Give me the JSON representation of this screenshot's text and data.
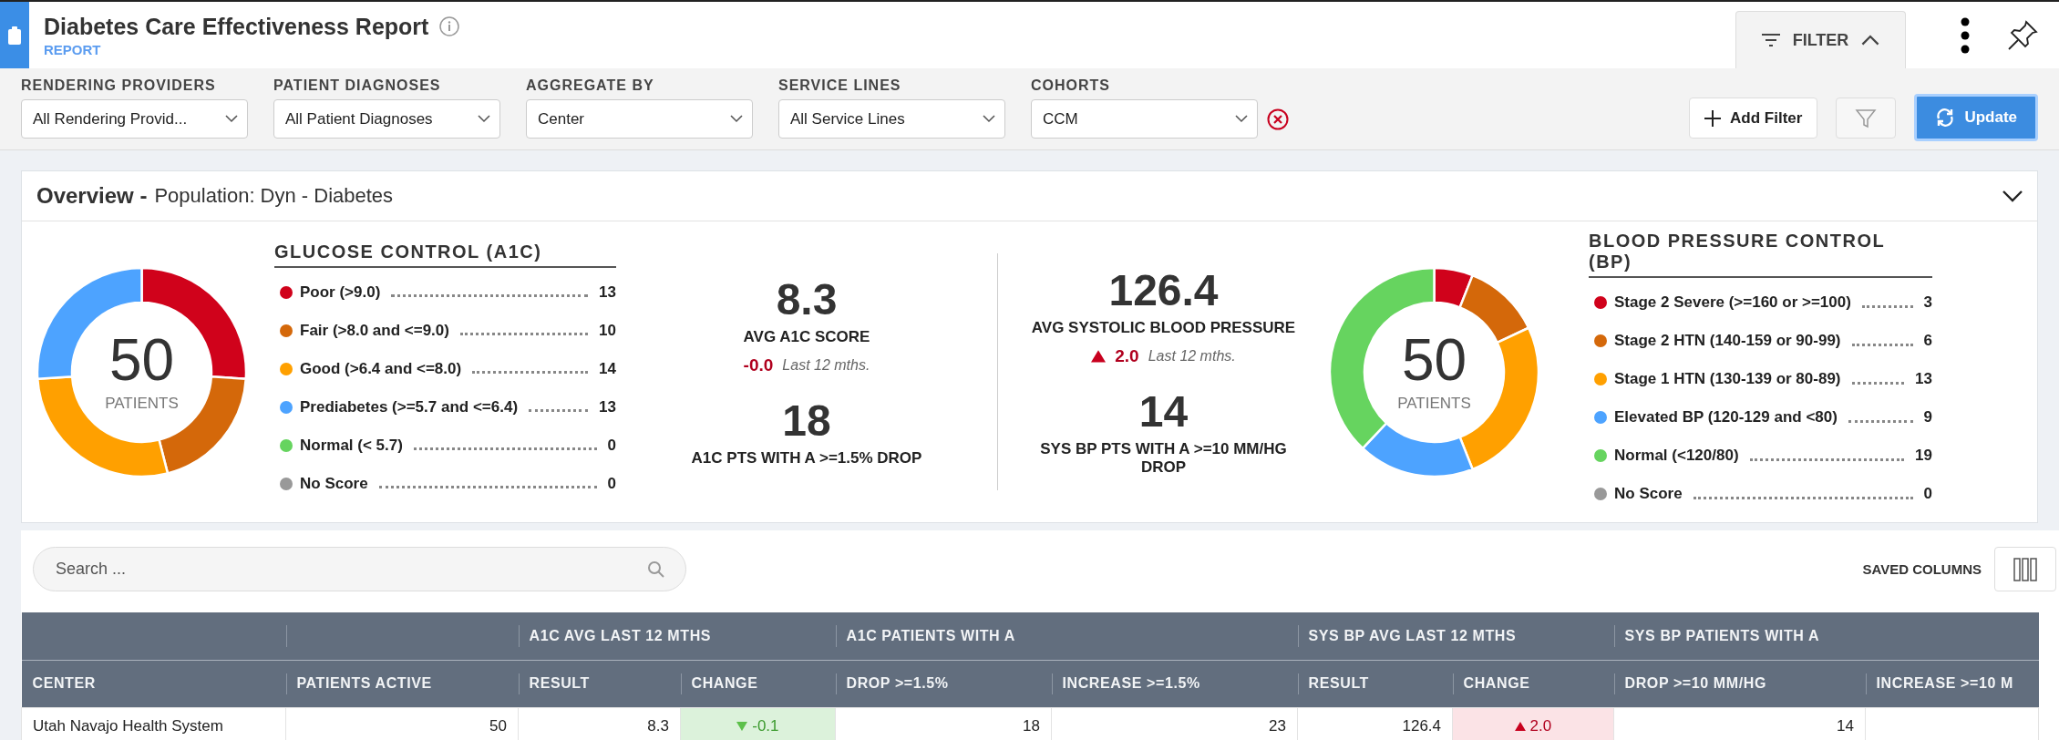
{
  "header": {
    "title": "Diabetes Care Effectiveness Report",
    "subtitle": "REPORT",
    "filter_tab": {
      "label": "FILTER",
      "expanded": true
    }
  },
  "filters": [
    {
      "label": "RENDERING PROVIDERS",
      "value": "All Rendering Provid...",
      "removable": false
    },
    {
      "label": "PATIENT DIAGNOSES",
      "value": "All Patient Diagnoses",
      "removable": false
    },
    {
      "label": "AGGREGATE BY",
      "value": "Center",
      "removable": false
    },
    {
      "label": "SERVICE LINES",
      "value": "All Service Lines",
      "removable": false
    },
    {
      "label": "COHORTS",
      "value": "CCM",
      "removable": true
    }
  ],
  "filter_actions": {
    "add_filter": "Add Filter",
    "update": "Update"
  },
  "overview": {
    "title": "Overview -",
    "population": "Population: Dyn - Diabetes",
    "glucose": {
      "title": "GLUCOSE CONTROL (A1C)",
      "total": "50",
      "total_label": "PATIENTS",
      "chart_data": {
        "type": "donut",
        "values": [
          26,
          20,
          28,
          26,
          0,
          0
        ]
      },
      "legend": [
        {
          "label": "Poor (>9.0)",
          "count": "13",
          "color": "#d0021b"
        },
        {
          "label": "Fair (>8.0 and <=9.0)",
          "count": "10",
          "color": "#d4680a"
        },
        {
          "label": "Good (>6.4 and <=8.0)",
          "count": "14",
          "color": "#ffa000"
        },
        {
          "label": "Prediabetes (>=5.7 and <=6.4)",
          "count": "13",
          "color": "#4da3ff"
        },
        {
          "label": "Normal (< 5.7)",
          "count": "0",
          "color": "#66d45f"
        },
        {
          "label": "No Score",
          "count": "0",
          "color": "#999999"
        }
      ]
    },
    "glucose_stats": {
      "value": "8.3",
      "label": "AVG A1C SCORE",
      "change": {
        "value": "-0.0",
        "rising": false,
        "period": "Last 12 mths."
      },
      "count": "18",
      "count_label": "A1C PTS WITH A >=1.5% DROP"
    },
    "bp_stats": {
      "value": "126.4",
      "label": "AVG SYSTOLIC BLOOD PRESSURE",
      "change": {
        "value": "2.0",
        "rising": true,
        "period": "Last 12 mths."
      },
      "count": "14",
      "count_label": "SYS BP PTS WITH A >=10 MM/HG DROP"
    },
    "bp": {
      "title": "BLOOD PRESSURE CONTROL (BP)",
      "total": "50",
      "total_label": "PATIENTS",
      "chart_data": {
        "type": "donut",
        "values": [
          6,
          12,
          26,
          18,
          38,
          0
        ]
      },
      "legend": [
        {
          "label": "Stage 2 Severe (>=160 or >=100)",
          "count": "3",
          "color": "#d0021b"
        },
        {
          "label": "Stage 2 HTN (140-159 or 90-99)",
          "count": "6",
          "color": "#d4680a"
        },
        {
          "label": "Stage 1 HTN (130-139 or 80-89)",
          "count": "13",
          "color": "#ffa000"
        },
        {
          "label": "Elevated BP (120-129 and <80)",
          "count": "9",
          "color": "#4da3ff"
        },
        {
          "label": "Normal (<120/80)",
          "count": "19",
          "color": "#66d45f"
        },
        {
          "label": "No Score",
          "count": "0",
          "color": "#999999"
        }
      ]
    }
  },
  "search": {
    "placeholder": "Search ..."
  },
  "saved_columns": "SAVED COLUMNS",
  "table": {
    "column_groups": [
      "A1C AVG LAST 12 MTHS",
      "A1C PATIENTS WITH A",
      "SYS BP AVG LAST 12 MTHS",
      "SYS BP PATIENTS WITH A"
    ],
    "columns": [
      "CENTER",
      "PATIENTS ACTIVE",
      "RESULT",
      "CHANGE",
      "DROP >=1.5%",
      "INCREASE >=1.5%",
      "RESULT",
      "CHANGE",
      "DROP >=10 MM/HG",
      "INCREASE >=10 M"
    ],
    "rows": [
      {
        "cells": [
          {
            "kind": "text",
            "value": "Utah Navajo Health System"
          },
          {
            "kind": "number",
            "value": "50"
          },
          {
            "kind": "number",
            "value": "8.3"
          },
          {
            "kind": "fall",
            "value": "-0.1"
          },
          {
            "kind": "number",
            "value": "18"
          },
          {
            "kind": "number",
            "value": "23"
          },
          {
            "kind": "number",
            "value": "126.4"
          },
          {
            "kind": "rise",
            "value": "2.0"
          },
          {
            "kind": "number",
            "value": "14"
          }
        ]
      }
    ]
  }
}
